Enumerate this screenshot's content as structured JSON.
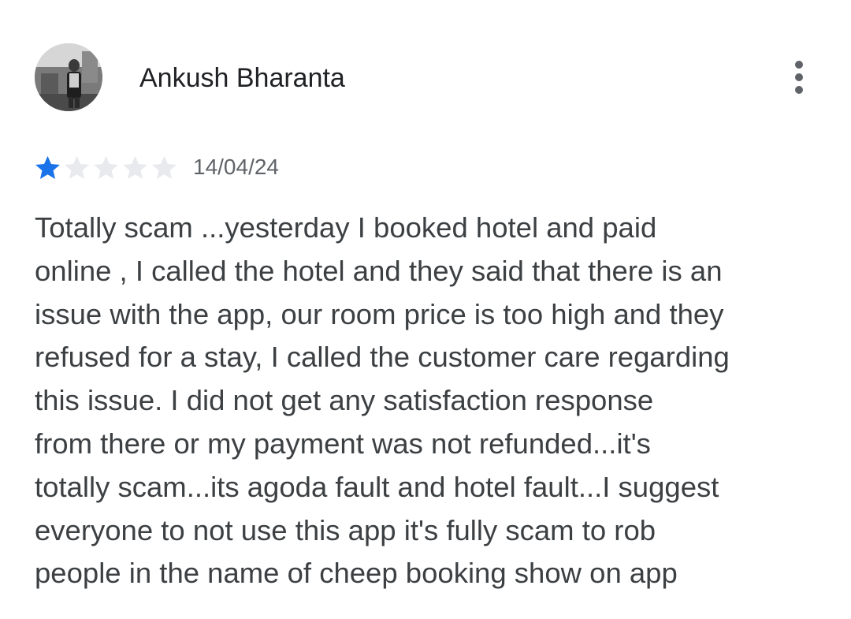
{
  "review": {
    "author": {
      "name": "Ankush Bharanta",
      "avatar_icon": "profile-photo"
    },
    "more_options_icon": "more-vert-icon",
    "rating": {
      "value": 1,
      "max": 5,
      "filled_color": "#1a73e8",
      "empty_color": "#e8eaed"
    },
    "date": "14/04/24",
    "text_lines": [
      "Totally scam ...yesterday I booked hotel and paid",
      "online , I called the hotel and they said that there is an",
      "issue with the app, our room price is too high and they",
      "refused for a stay, I called the customer care regarding",
      "this issue. I did not get any satisfaction response",
      "from there or my payment was not refunded...it's",
      "totally scam...its agoda fault and hotel fault...I suggest",
      "everyone to not use this app it's fully scam to rob",
      "people in the name of cheep booking show on app"
    ]
  }
}
